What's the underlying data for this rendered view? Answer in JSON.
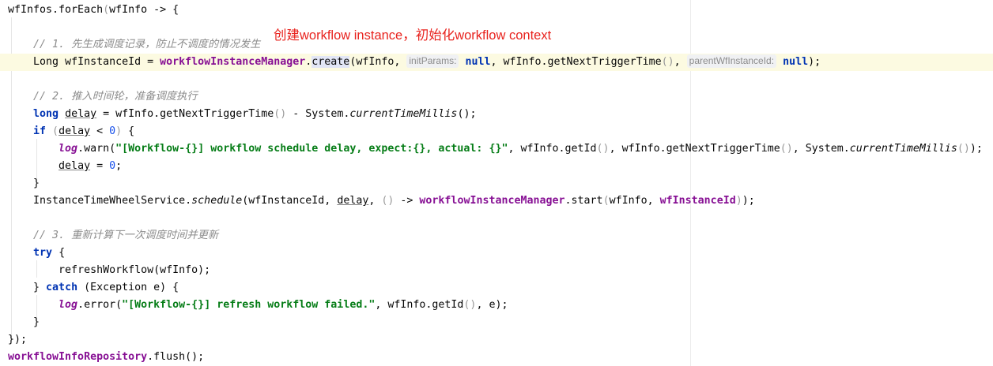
{
  "annotation": "创建workflow instance，初始化workflow context",
  "code": {
    "l1": {
      "a": "wfInfos.forEach",
      "b": "(",
      "c": "wfInfo -> ",
      "d": "{"
    },
    "l3": "// 1. 先生成调度记录，防止不调度的情况发生",
    "l4": {
      "a": "Long wfInstanceId = ",
      "b": "workflowInstanceManager",
      "c": ".",
      "d": "create",
      "e": "(wfInfo,",
      "hint1": "initParams:",
      "f": "null",
      "g": ", wfInfo.getNextTriggerTime",
      "h": "()",
      "i": ",",
      "hint2": "parentWfInstanceId:",
      "j": "null",
      "k": ");"
    },
    "l6": "// 2. 推入时间轮，准备调度执行",
    "l7": {
      "a": "long",
      "b": "delay",
      "c": " = wfInfo.getNextTriggerTime",
      "d": "()",
      "e": " - System.",
      "f": "currentTimeMillis",
      "g": "();"
    },
    "l8": {
      "a": "if",
      "b": " (",
      "c": "delay",
      "d": " < ",
      "e": "0",
      "f": ") ",
      "g": "{"
    },
    "l9": {
      "a": "log",
      "b": ".warn(",
      "c": "\"[Workflow-{}] workflow schedule delay, expect:{}, actual: {}\"",
      "d": ", wfInfo.getId",
      "e": "()",
      "f": ", wfInfo.getNextTriggerTime",
      "g": "()",
      "h": ", System.",
      "i": "currentTimeMillis",
      "j": "()",
      "k": ");"
    },
    "l10": {
      "a": "delay",
      "b": " = ",
      "c": "0",
      "d": ";"
    },
    "l11": "}",
    "l12": {
      "a": "InstanceTimeWheelService.",
      "b": "schedule",
      "c": "(wfInstanceId, ",
      "d": "delay",
      "e": ", ",
      "f": "()",
      "g": " -> ",
      "h": "workflowInstanceManager",
      "i": ".start",
      "j": "(",
      "k": "wfInfo, ",
      "l": "wfInstanceId",
      "m": ")",
      "n": ");"
    },
    "l14": "// 3. 重新计算下一次调度时间并更新",
    "l15": {
      "a": "try",
      "b": " {"
    },
    "l16": "refreshWorkflow(wfInfo);",
    "l17": {
      "a": "} ",
      "b": "catch",
      "c": " (Exception e) {"
    },
    "l18": {
      "a": "log",
      "b": ".error(",
      "c": "\"[Workflow-{}] refresh workflow failed.\"",
      "d": ", wfInfo.getId",
      "e": "()",
      "f": ", e);"
    },
    "l19": "}",
    "l20": {
      "a": "})",
      "b": ";"
    },
    "l21": {
      "a": "workflowInfoRepository",
      "b": ".flush();"
    }
  }
}
